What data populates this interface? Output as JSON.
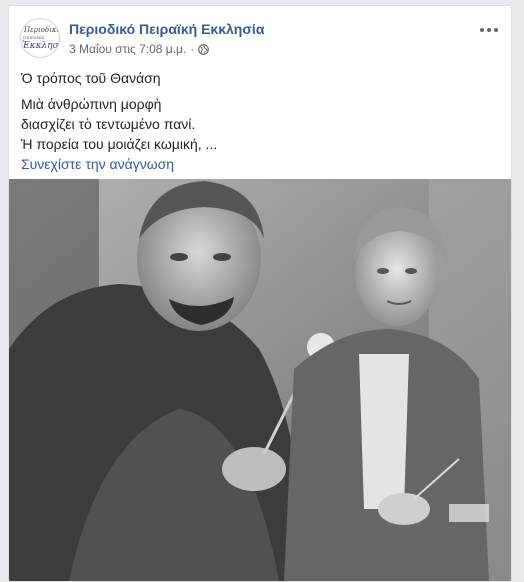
{
  "post": {
    "page_name": "Περιοδικό Πειραϊκή Εκκλησία",
    "timestamp": "3 Μαΐου στις 7:08 μ.μ.",
    "separator": "·",
    "privacy_icon": "globe-icon",
    "menu_icon": "more-options-icon",
    "title_line": "Ὁ τρόπος τοῦ Θανάση",
    "body_lines": [
      "Μιὰ ἀνθρώπινη μορφὴ",
      "διασχίζει τὸ τεντωμένο πανί.",
      "Ἡ πορεία του μοιάζει κωμική, ..."
    ],
    "continue_link": "Συνεχίστε την ανάγνωση"
  },
  "avatar": {
    "line1": "Περιοδικὸ",
    "line2": "ΠΕΙΡΑΪΚΗ",
    "line3": "Ἐκκλησία"
  },
  "colors": {
    "link": "#385898",
    "text": "#1d2129",
    "meta": "#616770",
    "background": "#e9ebee"
  }
}
